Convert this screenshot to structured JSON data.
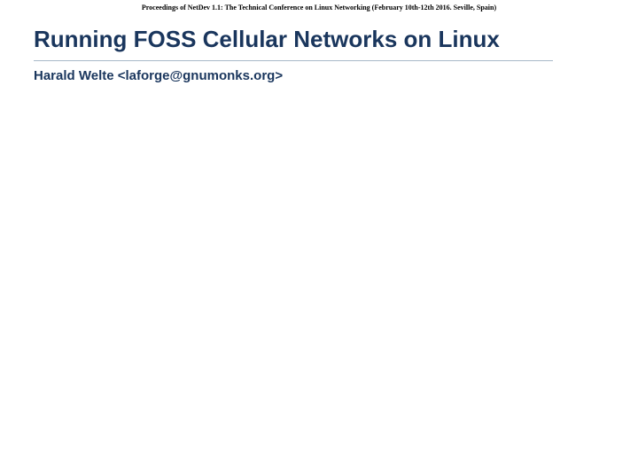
{
  "header": {
    "proceedings": "Proceedings of NetDev 1.1: The Technical Conference on Linux Networking (February 10th-12th 2016. Seville, Spain)"
  },
  "title": "Running FOSS Cellular Networks on Linux",
  "author": "Harald Welte <laforge@gnumonks.org>"
}
